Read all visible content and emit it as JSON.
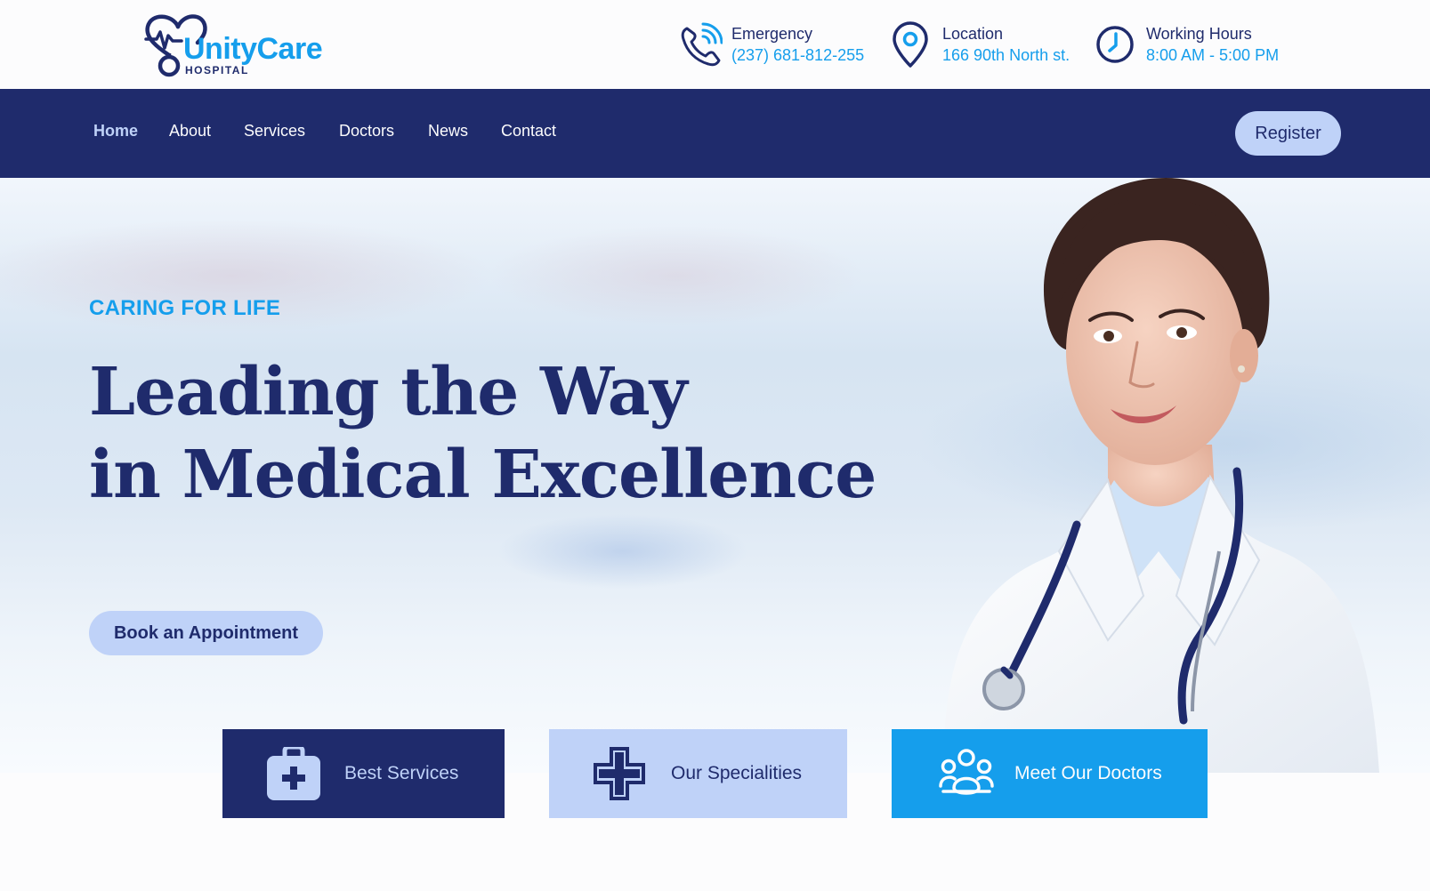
{
  "brand": {
    "name": "UnityCare",
    "subtitle": "HOSPITAL",
    "logo_icon": "heart-stethoscope-icon"
  },
  "header_info": [
    {
      "icon": "phone-icon",
      "label": "Emergency",
      "value": "(237) 681-812-255"
    },
    {
      "icon": "location-pin-icon",
      "label": "Location",
      "value": "166 90th North st."
    },
    {
      "icon": "clock-icon",
      "label": "Working Hours",
      "value": "8:00 AM - 5:00 PM"
    }
  ],
  "nav": {
    "items": [
      {
        "label": "Home",
        "active": true
      },
      {
        "label": "About",
        "active": false
      },
      {
        "label": "Services",
        "active": false
      },
      {
        "label": "Doctors",
        "active": false
      },
      {
        "label": "News",
        "active": false
      },
      {
        "label": "Contact",
        "active": false
      }
    ],
    "register_label": "Register"
  },
  "hero": {
    "tagline": "CARING FOR LIFE",
    "headline_line1": "Leading the Way",
    "headline_line2": "in Medical Excellence",
    "cta_label": "Book an Appointment"
  },
  "feature_cards": [
    {
      "icon": "medical-kit-icon",
      "label": "Best Services"
    },
    {
      "icon": "medical-cross-icon",
      "label": "Our Specialities"
    },
    {
      "icon": "team-icon",
      "label": "Meet Our Doctors"
    }
  ],
  "colors": {
    "navy": "#1f2b6c",
    "accent_blue": "#159eec",
    "light_blue": "#bfd2f8",
    "white": "#fcfcfd"
  }
}
